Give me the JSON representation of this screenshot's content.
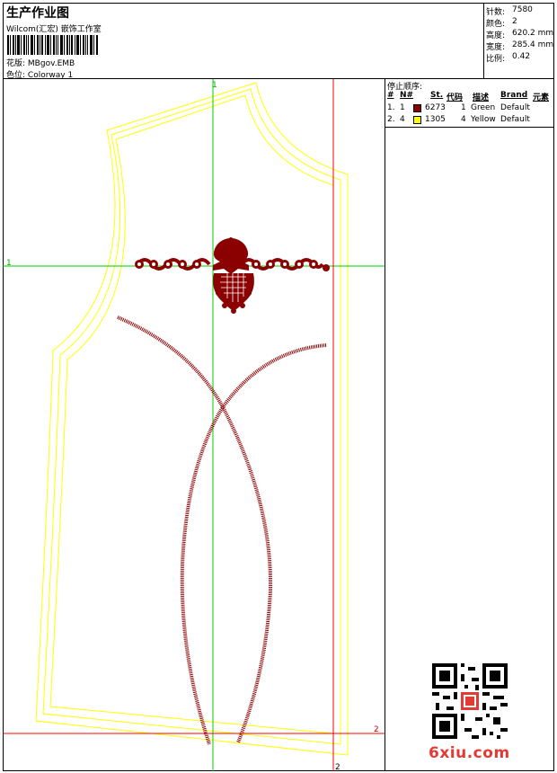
{
  "header": {
    "title": "生产作业图",
    "company": "Wilcom(汇宏) 嵌饰工作室",
    "design_label": "花版:",
    "design_value": "MBgov.EMB",
    "colorway_label": "色位:",
    "colorway_value": "Colorway 1"
  },
  "stats": [
    {
      "label": "针数:",
      "value": "7580"
    },
    {
      "label": "颜色:",
      "value": "2"
    },
    {
      "label": "高度:",
      "value": "620.2 mm"
    },
    {
      "label": "宽度:",
      "value": "285.4 mm"
    },
    {
      "label": "比例:",
      "value": "0.42"
    }
  ],
  "stop_sequence": {
    "title": "停止顺序:",
    "columns": [
      "#",
      "N#",
      "St.",
      "代码",
      "描述",
      "Brand",
      "元素"
    ],
    "rows": [
      {
        "idx": "1.",
        "needle": "1",
        "color": "#8B0000",
        "code": "6273",
        "count": "1",
        "desc": "Green",
        "brand": "Default"
      },
      {
        "idx": "2.",
        "needle": "4",
        "color": "#FFFF00",
        "code": "1305",
        "count": "4",
        "desc": "Yellow",
        "brand": "Default"
      }
    ]
  },
  "canvas": {
    "marker_top": "1",
    "marker_left": "1",
    "marker_right": "2",
    "marker_bottom": "2",
    "guide_color_green": "#00CC00",
    "guide_color_red": "#FF0000",
    "outline_color": "#FFFF00",
    "stitch_color": "#8B0000"
  },
  "watermark": "6xiu.com"
}
